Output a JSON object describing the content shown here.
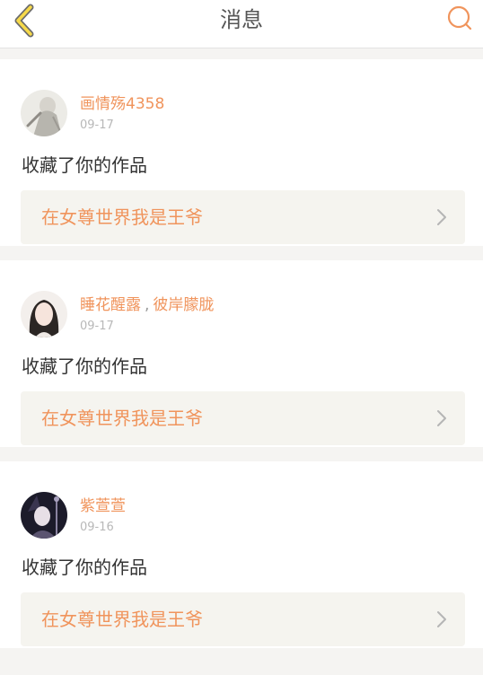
{
  "header": {
    "title": "消息",
    "back_icon": "chevron-left-icon",
    "search_icon": "search-icon",
    "accent_color": "#f0945c"
  },
  "messages": [
    {
      "users": [
        "画情殇4358"
      ],
      "date": "09-17",
      "action": "收藏了你的作品",
      "work_title": "在女尊世界我是王爷"
    },
    {
      "users": [
        "睡花醒露",
        "彼岸朦胧"
      ],
      "separator": ",",
      "date": "09-17",
      "action": "收藏了你的作品",
      "work_title": "在女尊世界我是王爷"
    },
    {
      "users": [
        "紫萱萱"
      ],
      "date": "09-16",
      "action": "收藏了你的作品",
      "work_title": "在女尊世界我是王爷"
    }
  ]
}
